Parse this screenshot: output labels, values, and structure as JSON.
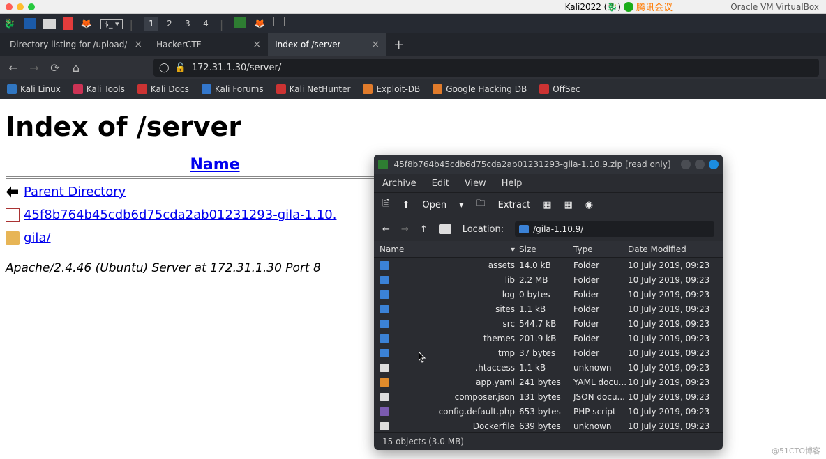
{
  "mac": {
    "title": "Kali2022 (🐉)",
    "tencent": "腾讯会议",
    "oracle": "Oracle VM VirtualBox"
  },
  "workspaces": [
    "1",
    "2",
    "3",
    "4"
  ],
  "tabs": [
    {
      "label": "Directory listing for /upload/",
      "active": false
    },
    {
      "label": "HackerCTF",
      "active": false
    },
    {
      "label": "Index of /server",
      "active": true
    }
  ],
  "addressbar": {
    "url": "172.31.1.30/server/"
  },
  "bookmarks": [
    {
      "label": "Kali Linux",
      "color": "#3076c1"
    },
    {
      "label": "Kali Tools",
      "color": "#c35"
    },
    {
      "label": "Kali Docs",
      "color": "#c33"
    },
    {
      "label": "Kali Forums",
      "color": "#37c"
    },
    {
      "label": "Kali NetHunter",
      "color": "#c33"
    },
    {
      "label": "Exploit-DB",
      "color": "#e07b2b"
    },
    {
      "label": "Google Hacking DB",
      "color": "#e07b2b"
    },
    {
      "label": "OffSec",
      "color": "#c33"
    }
  ],
  "page": {
    "heading": "Index of /server",
    "name_header": "Name",
    "entries": [
      {
        "icon": "back",
        "label": "Parent Directory"
      },
      {
        "icon": "zip",
        "label": "45f8b764b45cdb6d75cda2ab01231293-gila-1.10."
      },
      {
        "icon": "folder",
        "label": "gila/"
      }
    ],
    "footer": "Apache/2.4.46 (Ubuntu) Server at 172.31.1.30 Port 8"
  },
  "archive": {
    "title": "45f8b764b45cdb6d75cda2ab01231293-gila-1.10.9.zip [read only]",
    "menus": [
      "Archive",
      "Edit",
      "View",
      "Help"
    ],
    "toolbar": {
      "open": "Open",
      "extract": "Extract"
    },
    "location_label": "Location:",
    "location": "/gila-1.10.9/",
    "columns": {
      "name": "Name",
      "size": "Size",
      "type": "Type",
      "date": "Date Modified"
    },
    "files": [
      {
        "icon": "folder",
        "name": "assets",
        "size": "14.0 kB",
        "type": "Folder",
        "date": "10 July 2019, 09:23"
      },
      {
        "icon": "folder",
        "name": "lib",
        "size": "2.2 MB",
        "type": "Folder",
        "date": "10 July 2019, 09:23"
      },
      {
        "icon": "folder",
        "name": "log",
        "size": "0 bytes",
        "type": "Folder",
        "date": "10 July 2019, 09:23"
      },
      {
        "icon": "folder",
        "name": "sites",
        "size": "1.1 kB",
        "type": "Folder",
        "date": "10 July 2019, 09:23"
      },
      {
        "icon": "folder",
        "name": "src",
        "size": "544.7 kB",
        "type": "Folder",
        "date": "10 July 2019, 09:23"
      },
      {
        "icon": "folder",
        "name": "themes",
        "size": "201.9 kB",
        "type": "Folder",
        "date": "10 July 2019, 09:23"
      },
      {
        "icon": "folder",
        "name": "tmp",
        "size": "37 bytes",
        "type": "Folder",
        "date": "10 July 2019, 09:23"
      },
      {
        "icon": "file",
        "name": ".htaccess",
        "size": "1.1 kB",
        "type": "unknown",
        "date": "10 July 2019, 09:23"
      },
      {
        "icon": "yaml",
        "name": "app.yaml",
        "size": "241 bytes",
        "type": "YAML docu...",
        "date": "10 July 2019, 09:23"
      },
      {
        "icon": "file",
        "name": "composer.json",
        "size": "131 bytes",
        "type": "JSON docu...",
        "date": "10 July 2019, 09:23"
      },
      {
        "icon": "php",
        "name": "config.default.php",
        "size": "653 bytes",
        "type": "PHP script",
        "date": "10 July 2019, 09:23"
      },
      {
        "icon": "file",
        "name": "Dockerfile",
        "size": "639 bytes",
        "type": "unknown",
        "date": "10 July 2019, 09:23"
      }
    ],
    "status": "15 objects (3.0 MB)"
  },
  "watermark": "@51CTO博客"
}
